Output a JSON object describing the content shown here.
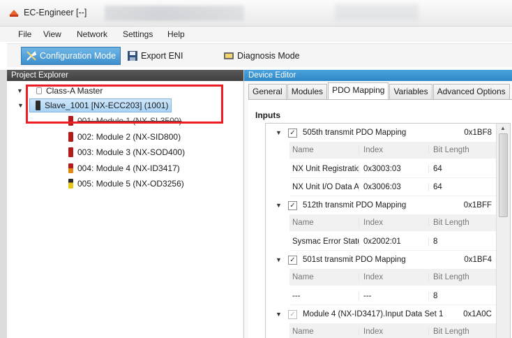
{
  "window": {
    "title": "EC-Engineer [--]"
  },
  "menu": [
    "File",
    "View",
    "Network",
    "Settings",
    "Help"
  ],
  "toolbar": {
    "configuration_mode": "Configuration Mode",
    "export_eni": "Export ENI",
    "diagnosis_mode": "Diagnosis Mode"
  },
  "project_explorer": {
    "header": "Project Explorer",
    "master": "Class-A Master",
    "slave": "Slave_1001 [NX-ECC203] (1001)",
    "modules": [
      {
        "label": "001: Module 1 (NX-SL3500)",
        "color": "#b31b1b"
      },
      {
        "label": "002: Module 2 (NX-SID800)",
        "color": "#b31b1b"
      },
      {
        "label": "003: Module 3 (NX-SOD400)",
        "color": "#b31b1b"
      },
      {
        "label": "004: Module 4 (NX-ID3417)",
        "color": "#e08a12"
      },
      {
        "label": "005: Module 5 (NX-OD3256)",
        "color": "#e6c619"
      }
    ]
  },
  "device_editor": {
    "header": "Device Editor",
    "tabs": [
      "General",
      "Modules",
      "PDO Mapping",
      "Variables",
      "Advanced Options"
    ],
    "active_tab": "PDO Mapping",
    "inputs_label": "Inputs",
    "columns": [
      "Name",
      "Index",
      "Bit Length"
    ],
    "groups": [
      {
        "name": "505th transmit PDO Mapping",
        "index": "0x1BF8",
        "rows": [
          [
            "NX Unit Registration",
            "0x3003:03",
            "64"
          ],
          [
            "NX Unit I/O Data Active",
            "0x3006:03",
            "64"
          ]
        ]
      },
      {
        "name": "512th transmit PDO Mapping",
        "index": "0x1BFF",
        "rows": [
          [
            "Sysmac Error Status",
            "0x2002:01",
            "8"
          ]
        ]
      },
      {
        "name": "501st transmit PDO Mapping",
        "index": "0x1BF4",
        "rows": [
          [
            "---",
            "---",
            "8"
          ]
        ]
      },
      {
        "name": "Module 4 (NX-ID3417).Input Data Set 1",
        "index": "0x1A0C",
        "rows": []
      }
    ]
  },
  "colors": {
    "selection_highlight": "#ee1c25",
    "active_mode": "#3d8fcc",
    "pane_header": "#3f3f3f",
    "editor_header": "#3a94d0"
  }
}
